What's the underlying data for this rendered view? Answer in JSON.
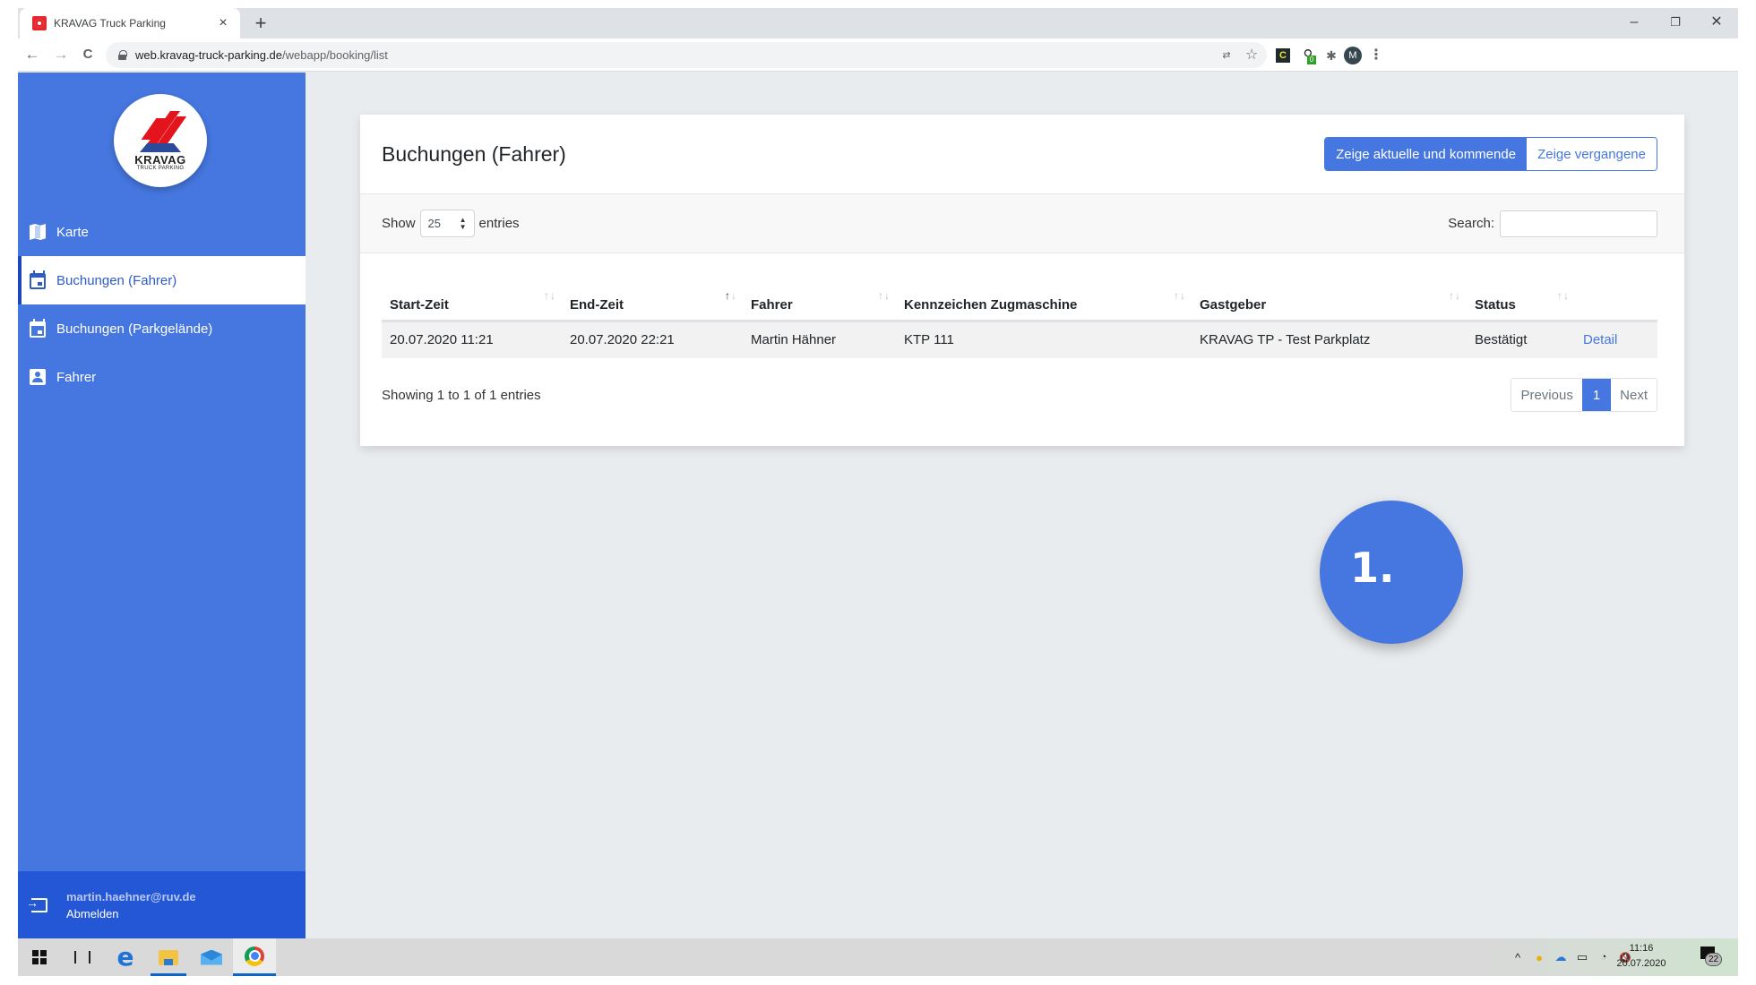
{
  "browser": {
    "tab_title": "KRAVAG Truck Parking",
    "tab_close": "×",
    "new_tab": "+",
    "url_host": "web.kravag-truck-parking.de",
    "url_path": "/webapp/booking/list",
    "nav_back": "←",
    "nav_forward": "→",
    "nav_reload": "C",
    "window_minimize": "–",
    "window_restore": "❐",
    "window_close": "✕",
    "ext_c_label": "C",
    "ext_badge_count": "0",
    "profile_initial": "M",
    "menu": "⋮",
    "star": "☆",
    "translate": "⇄"
  },
  "sidebar": {
    "logo_text": "KRAVAG",
    "logo_subtext": "TRUCK PARKING",
    "items": [
      {
        "label": "Karte",
        "icon": "map-icon",
        "active": false
      },
      {
        "label": "Buchungen (Fahrer)",
        "icon": "calendar-icon",
        "active": true
      },
      {
        "label": "Buchungen (Parkgelände)",
        "icon": "calendar-icon",
        "active": false
      },
      {
        "label": "Fahrer",
        "icon": "person-card-icon",
        "active": false
      }
    ],
    "footer": {
      "email": "martin.haehner@ruv.de",
      "logout_label": "Abmelden"
    }
  },
  "main": {
    "title": "Buchungen (Fahrer)",
    "filter_buttons": {
      "current": "Zeige aktuelle und kommende",
      "past": "Zeige vergangene"
    },
    "length": {
      "show_label": "Show",
      "value": "25",
      "entries_label": "entries"
    },
    "search": {
      "label": "Search:",
      "value": ""
    },
    "table": {
      "columns": [
        "Start-Zeit",
        "End-Zeit",
        "Fahrer",
        "Kennzeichen Zugmaschine",
        "Gastgeber",
        "Status",
        ""
      ],
      "sorted_column": "End-Zeit",
      "sort_direction": "ascending",
      "rows": [
        [
          "20.07.2020 11:21",
          "20.07.2020 22:21",
          "Martin Hähner",
          "KTP 111",
          "KRAVAG TP - Test Parkplatz",
          "Bestätigt",
          "Detail"
        ]
      ]
    },
    "info": "Showing 1 to 1 of 1 entries",
    "pagination": {
      "previous": "Previous",
      "current_page": "1",
      "next": "Next"
    }
  },
  "step_bubble": "1.",
  "taskbar": {
    "clock_time": "11:16",
    "clock_date": "20.07.2020",
    "notification_count": "22",
    "chevron": "^",
    "volume": "🔇"
  },
  "colors": {
    "accent": "#4677e0",
    "sidebar_footer": "#2457d6",
    "logo_red": "#e3141b"
  }
}
